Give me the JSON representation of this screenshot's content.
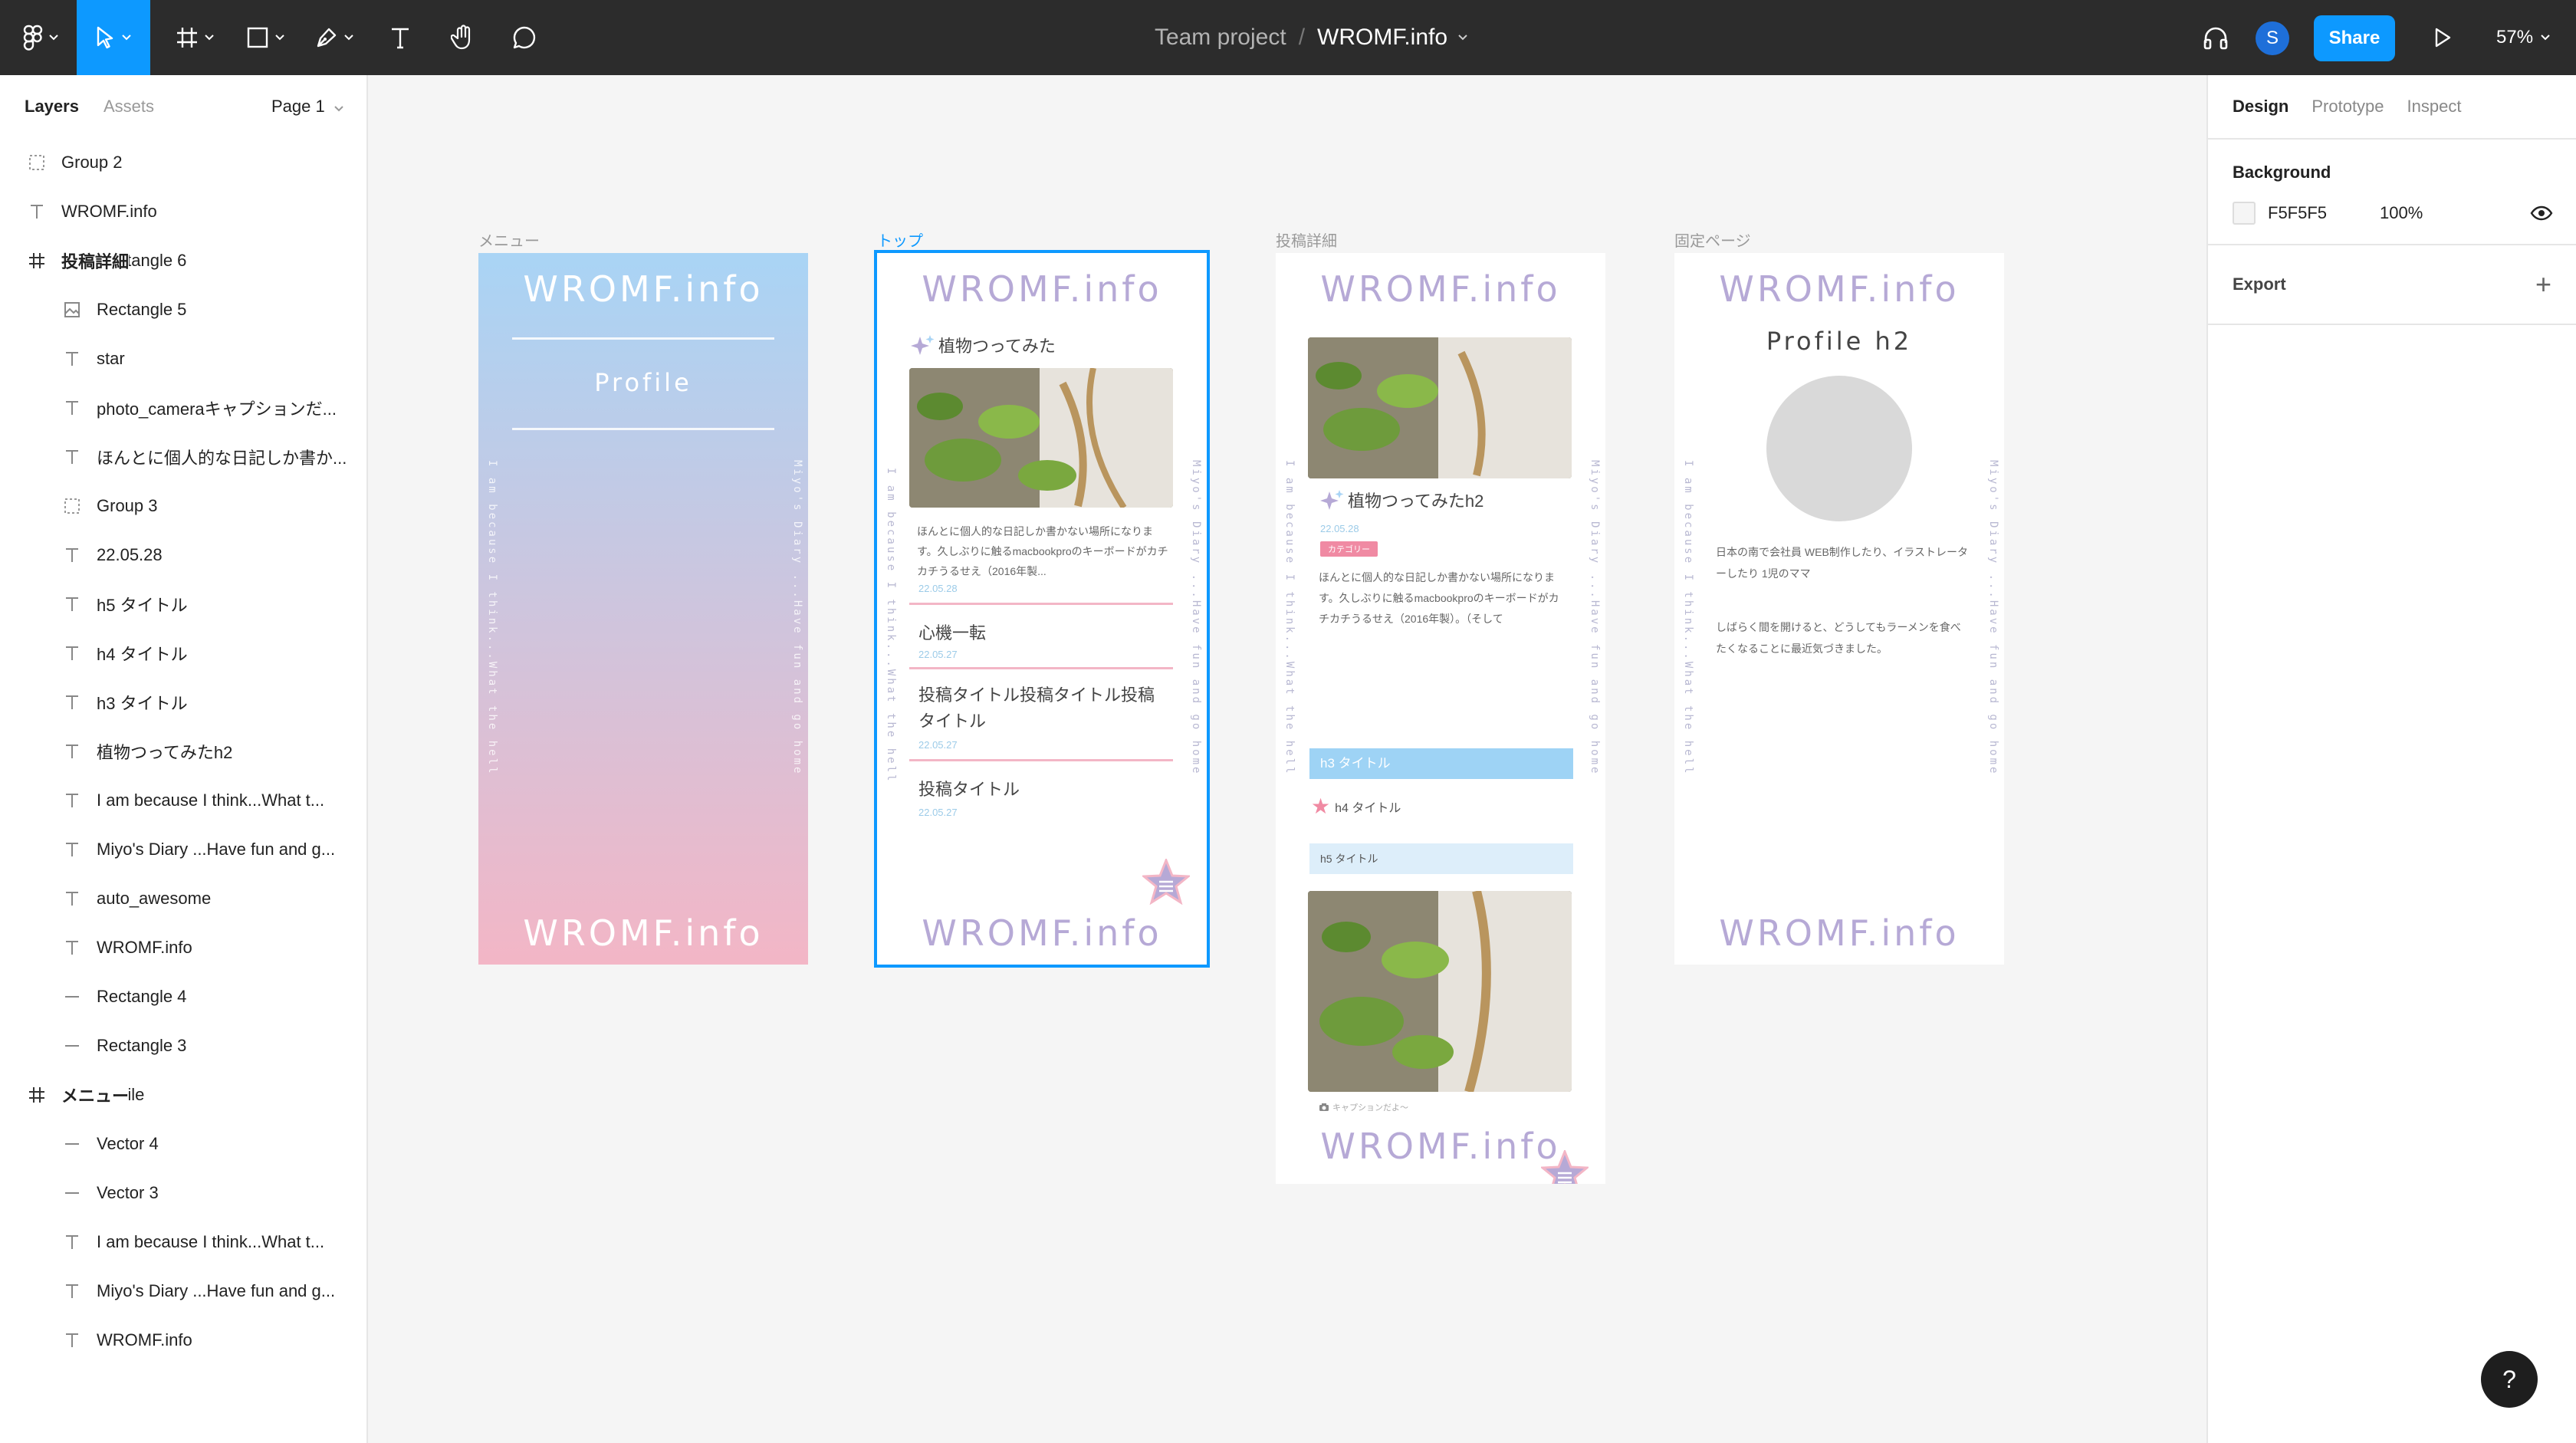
{
  "toolbar": {
    "project": "Team project",
    "separator": "/",
    "file": "WROMF.info",
    "avatar": "S",
    "share": "Share",
    "zoom": "57%"
  },
  "left_panel": {
    "tabs": [
      "Layers",
      "Assets"
    ],
    "page": "Page 1",
    "layers": [
      {
        "name": "Group 2",
        "icon": "group-icon"
      },
      {
        "name": "WROMF.info",
        "icon": "text-icon"
      },
      {
        "name": "投稿詳細",
        "icon": "frame-icon"
      },
      {
        "name": "Rectangle 6",
        "icon": "image-icon"
      },
      {
        "name": "Rectangle 5",
        "icon": "image-icon"
      },
      {
        "name": "star",
        "icon": "text-icon"
      },
      {
        "name": "photo_cameraキャプションだ...",
        "icon": "text-icon"
      },
      {
        "name": "ほんとに個人的な日記しか書か...",
        "icon": "text-icon"
      },
      {
        "name": "Group 3",
        "icon": "group-icon"
      },
      {
        "name": "22.05.28",
        "icon": "text-icon"
      },
      {
        "name": "h5 タイトル",
        "icon": "text-icon"
      },
      {
        "name": "h4 タイトル",
        "icon": "text-icon"
      },
      {
        "name": "h3 タイトル",
        "icon": "text-icon"
      },
      {
        "name": "植物つってみたh2",
        "icon": "text-icon"
      },
      {
        "name": "I am because I think...What t...",
        "icon": "text-icon"
      },
      {
        "name": "Miyo's Diary ...Have fun and g...",
        "icon": "text-icon"
      },
      {
        "name": "auto_awesome",
        "icon": "text-icon"
      },
      {
        "name": "WROMF.info",
        "icon": "text-icon"
      },
      {
        "name": "Rectangle 4",
        "icon": "line-icon"
      },
      {
        "name": "Rectangle 3",
        "icon": "line-icon"
      },
      {
        "name": "メニュー",
        "icon": "frame-icon"
      },
      {
        "name": "Profile",
        "icon": "text-icon"
      },
      {
        "name": "Vector 4",
        "icon": "line-icon"
      },
      {
        "name": "Vector 3",
        "icon": "line-icon"
      },
      {
        "name": "I am because I think...What t...",
        "icon": "text-icon"
      },
      {
        "name": "Miyo's Diary ...Have fun and g...",
        "icon": "text-icon"
      },
      {
        "name": "WROMF.info",
        "icon": "text-icon"
      }
    ]
  },
  "right_panel": {
    "tabs": [
      "Design",
      "Prototype",
      "Inspect"
    ],
    "background_label": "Background",
    "background_hex": "F5F5F5",
    "background_opacity": "100%",
    "export_label": "Export",
    "export_add": "+"
  },
  "frames": {
    "menu": {
      "label": "メニュー",
      "logo_top": "WROMF.info",
      "profile": "Profile",
      "vert_left": "I am because I think...What the hell",
      "vert_right": "Miyo's Diary ...Have fun and go home",
      "logo_bottom": "WROMF.info"
    },
    "top": {
      "label": "トップ",
      "logo_top": "WROMF.info",
      "feature_title": "植物つってみた",
      "excerpt": "ほんとに個人的な日記しか書かない場所になります。久しぶりに触るmacbookproのキーボードがカチカチうるせえ（2016年製...",
      "date": "22.05.28",
      "posts": [
        {
          "title": "心機一転",
          "date": "22.05.27"
        },
        {
          "title": "投稿タイトル投稿タイトル投稿タイトル",
          "date": "22.05.27"
        },
        {
          "title": "投稿タイトル",
          "date": "22.05.27"
        }
      ],
      "vert_left": "I am because I think...What the hell",
      "vert_right": "Miyo's Diary ...Have fun and go home",
      "logo_bottom": "WROMF.info"
    },
    "detail": {
      "label": "投稿詳細",
      "logo_top": "WROMF.info",
      "h2": "植物つってみたh2",
      "date": "22.05.28",
      "category": "カテゴリー",
      "body": "ほんとに個人的な日記しか書かない場所になります。久しぶりに触るmacbookproのキーボードがカチカチうるせえ（2016年製）。（そして",
      "h3": "h3 タイトル",
      "h4": "h4 タイトル",
      "h5": "h5 タイトル",
      "caption": "キャプションだよ〜",
      "vert_left": "I am because I think...What the hell",
      "vert_right": "Miyo's Diary ...Have fun and go home",
      "logo_bottom": "WROMF.info"
    },
    "fixed": {
      "label": "固定ページ",
      "logo_top": "WROMF.info",
      "h2": "Profile h2",
      "bio1": "日本の南で会社員 WEB制作したり、イラストレーターしたり 1児のママ",
      "bio2": "しばらく間を開けると、どうしてもラーメンを食べたくなることに最近気づきました。",
      "vert_left": "I am because I think...What the hell",
      "vert_right": "Miyo's Diary ...Have fun and go home",
      "logo_bottom": "WROMF.info"
    }
  },
  "help": "?",
  "colors": {
    "accent": "#0d99ff",
    "toolbar": "#2c2c2c",
    "logo": "#b6a9d6",
    "menu_gradient_top": "#a9d4f5",
    "menu_gradient_bottom": "#f3b6c6",
    "h3_bg": "#9ed3f5",
    "h5_bg": "#ddeefa",
    "pink": "#f3b6c6",
    "category": "#f08aa3"
  }
}
